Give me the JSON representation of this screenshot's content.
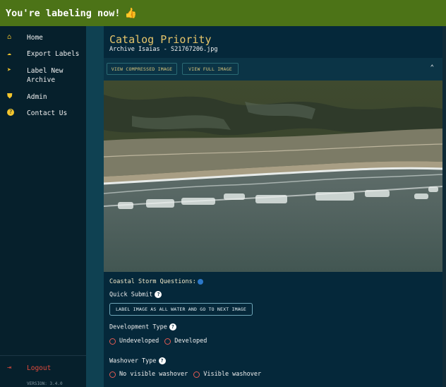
{
  "topbar": {
    "message": "You're labeling now!",
    "emoji": "👍"
  },
  "sidebar": {
    "items": [
      {
        "icon": "home-icon",
        "glyph": "⌂",
        "label": "Home"
      },
      {
        "icon": "cloud-upload-icon",
        "glyph": "☁",
        "label": "Export Labels"
      },
      {
        "icon": "label-icon",
        "glyph": "➤",
        "label": "Label New Archive"
      },
      {
        "icon": "shield-icon",
        "glyph": "⛊",
        "label": "Admin"
      },
      {
        "icon": "help-circle-icon",
        "glyph": "?",
        "label": "Contact Us"
      }
    ],
    "logout": {
      "icon": "logout-icon",
      "glyph": "⇥",
      "label": "Logout"
    },
    "version": "VERSION: 3.4.0"
  },
  "header": {
    "title": "Catalog Priority",
    "subtitle": "Archive Isaias - S21767206.jpg"
  },
  "toolbar": {
    "view_compressed": "VIEW COMPRESSED IMAGE",
    "view_full": "VIEW FULL IMAGE",
    "collapse_glyph": "⌃"
  },
  "image": {
    "alt_subject": "Aerial photo of coastal beach with dunes and surf"
  },
  "questions": {
    "section_title": "Coastal Storm Questions:",
    "quick_submit": {
      "label": "Quick Submit",
      "button": "LABEL IMAGE AS ALL WATER AND GO TO NEXT IMAGE"
    },
    "development": {
      "label": "Development Type",
      "options": [
        "Undeveloped",
        "Developed"
      ]
    },
    "washover": {
      "label": "Washover Type",
      "options": [
        "No visible washover",
        "Visible washover"
      ]
    },
    "help_glyph": "?"
  },
  "colors": {
    "topbar": "#4c7317",
    "sidebar": "#06202c",
    "main": "#05283a",
    "accent_gold": "#e5c46a",
    "radio_red": "#e25a52"
  }
}
